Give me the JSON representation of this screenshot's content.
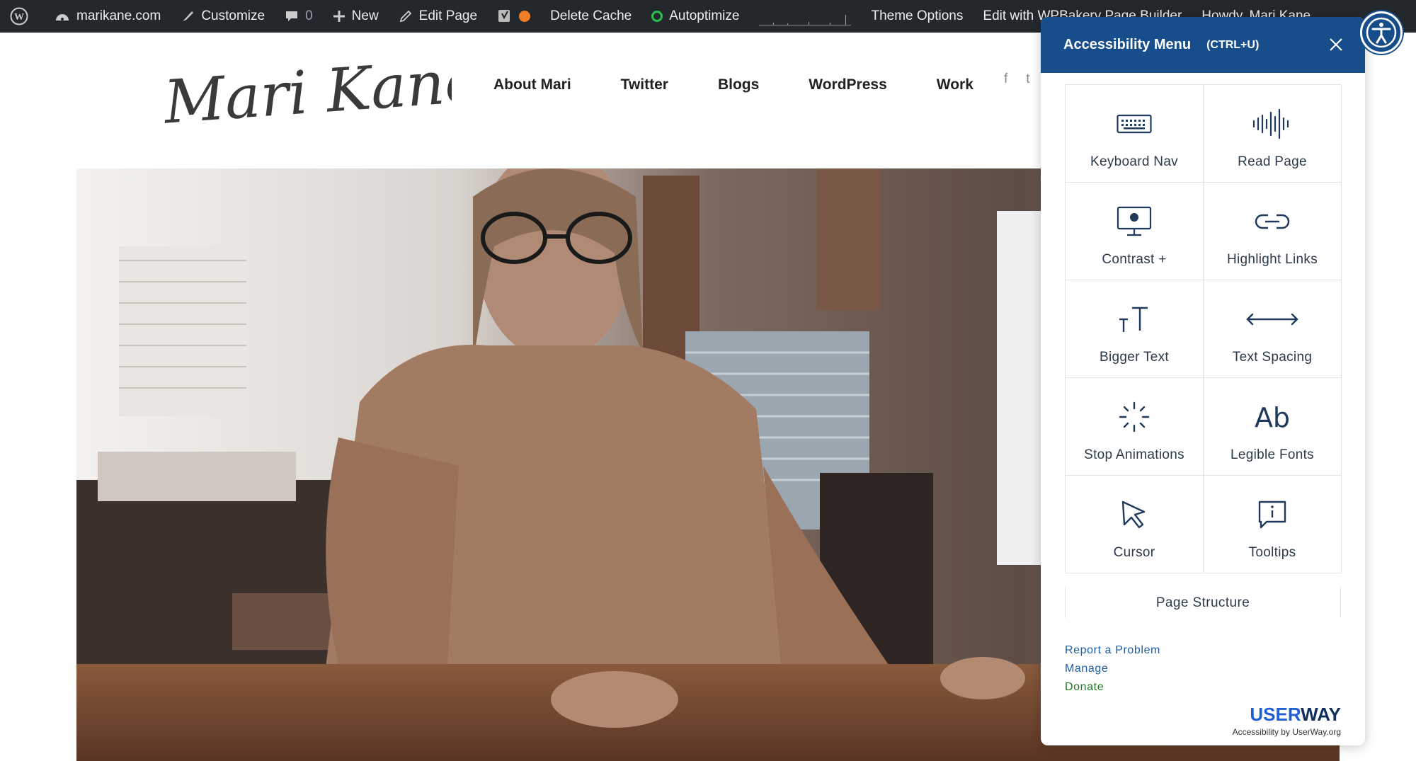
{
  "adminbar": {
    "site_name": "marikane.com",
    "customize": "Customize",
    "comments_count": "0",
    "new": "New",
    "edit_page": "Edit Page",
    "delete_cache": "Delete Cache",
    "autoptimize": "Autoptimize",
    "theme_options": "Theme Options",
    "edit_with": "Edit with WPBakery Page Builder",
    "howdy": "Howdy, Mari Kane"
  },
  "header": {
    "logo_text": "Mari Kane",
    "nav": [
      "About Mari",
      "Twitter",
      "Blogs",
      "WordPress",
      "Work"
    ]
  },
  "a11y": {
    "title": "Accessibility Menu",
    "shortcut": "(CTRL+U)",
    "tiles": [
      {
        "label": "Keyboard Nav",
        "icon": "keyboard-icon"
      },
      {
        "label": "Read Page",
        "icon": "audio-wave-icon"
      },
      {
        "label": "Contrast +",
        "icon": "monitor-icon"
      },
      {
        "label": "Highlight Links",
        "icon": "link-icon"
      },
      {
        "label": "Bigger Text",
        "icon": "text-size-icon"
      },
      {
        "label": "Text Spacing",
        "icon": "horizontal-arrows-icon"
      },
      {
        "label": "Stop Animations",
        "icon": "loading-spinner-icon"
      },
      {
        "label": "Legible Fonts",
        "icon": "font-ab-icon"
      },
      {
        "label": "Cursor",
        "icon": "cursor-arrow-icon"
      },
      {
        "label": "Tooltips",
        "icon": "tooltip-info-icon"
      }
    ],
    "page_structure": "Page Structure",
    "links": {
      "report": "Report a Problem",
      "manage": "Manage",
      "donate": "Donate"
    },
    "brand": {
      "logo_part1": "USER",
      "logo_part2": "WAY",
      "tagline": "Accessibility by UserWay.org"
    }
  },
  "colors": {
    "adminbar_bg": "#23282d",
    "panel_header": "#174d8b",
    "link_blue": "#1a5ea6",
    "link_green": "#1d7a1d"
  }
}
